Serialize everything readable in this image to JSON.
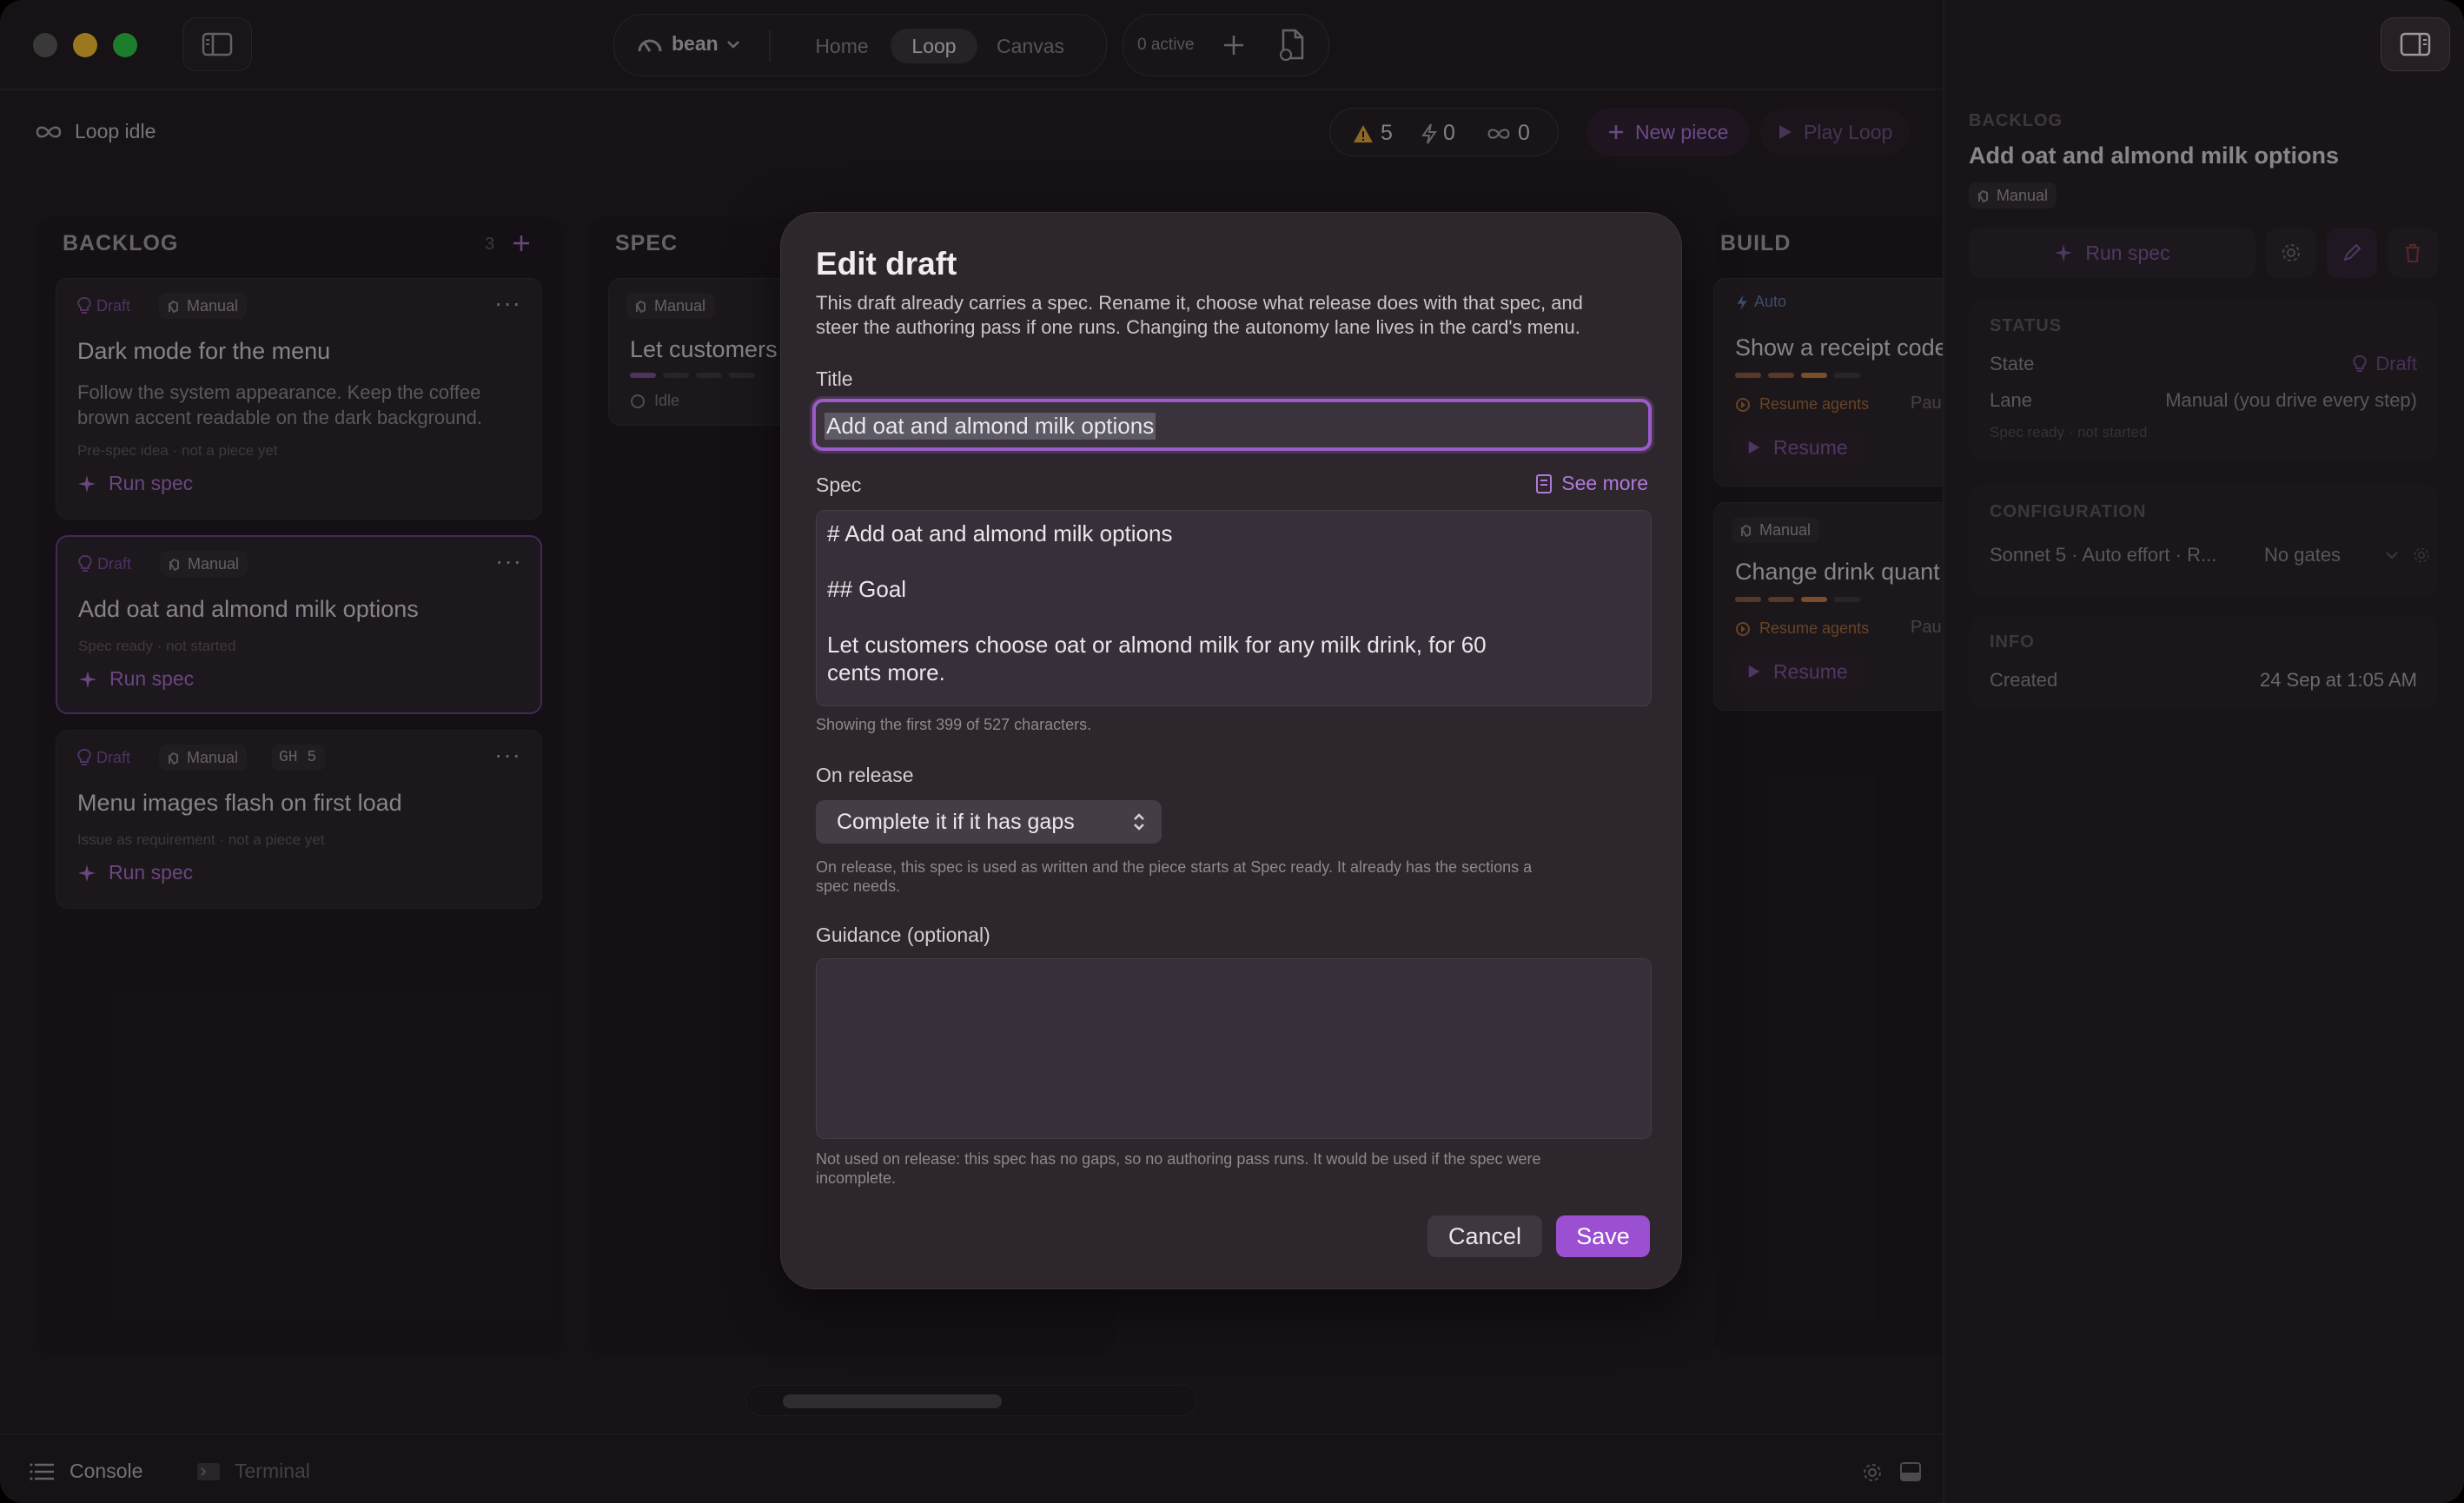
{
  "titlebar": {
    "project": "bean",
    "tabs": [
      "Home",
      "Loop",
      "Canvas"
    ],
    "active_tab": "Loop",
    "active_count": "0 active"
  },
  "toolbar": {
    "status": "Loop idle",
    "counts": {
      "warnings": "5",
      "running": "0",
      "loops": "0"
    },
    "new_piece": "New piece",
    "play_loop": "Play Loop"
  },
  "board": {
    "backlog": {
      "title": "BACKLOG",
      "count": "3",
      "cards": [
        {
          "status": "Draft",
          "lane": "Manual",
          "title": "Dark mode for the menu",
          "desc_line1": "Follow the system appearance. Keep the coffee",
          "desc_line2": "brown accent readable on the dark background.",
          "sub": "Pre-spec idea · not a piece yet",
          "action": "Run spec"
        },
        {
          "status": "Draft",
          "lane": "Manual",
          "title": "Add oat and almond milk options",
          "sub": "Spec ready · not started",
          "action": "Run spec"
        },
        {
          "status": "Draft",
          "lane": "Manual",
          "extra": "GH 5",
          "title": "Menu images flash on first load",
          "sub": "Issue as requirement · not a piece yet",
          "action": "Run spec"
        }
      ]
    },
    "spec": {
      "title": "SPEC",
      "cards": [
        {
          "lane": "Manual",
          "title": "Let customers",
          "state": "Idle"
        }
      ]
    },
    "build": {
      "title": "BUILD",
      "cards": [
        {
          "lane": "Auto",
          "title": "Show a receipt code",
          "agents": "Resume agents",
          "trail": "Pau",
          "action": "Resume"
        },
        {
          "lane": "Manual",
          "title": "Change drink quant",
          "agents": "Resume agents",
          "trail": "Pau",
          "action": "Resume"
        }
      ]
    }
  },
  "inspector": {
    "column": "BACKLOG",
    "title": "Add oat and almond milk options",
    "lane_badge": "Manual",
    "run_spec": "Run spec",
    "status": {
      "heading": "STATUS",
      "state_label": "State",
      "state_value": "Draft",
      "lane_label": "Lane",
      "lane_value": "Manual (you drive every step)",
      "note": "Spec ready · not started"
    },
    "configuration": {
      "heading": "CONFIGURATION",
      "summary": "Sonnet 5 · Auto effort · R...",
      "gates": "No gates"
    },
    "info": {
      "heading": "INFO",
      "created_label": "Created",
      "created_value": "24 Sep at 1:05 AM"
    }
  },
  "bottombar": {
    "console": "Console",
    "terminal": "Terminal"
  },
  "modal": {
    "title": "Edit draft",
    "intro_line1": "This draft already carries a spec. Rename it, choose what release does with that spec, and",
    "intro_line2": "steer the authoring pass if one runs. Changing the autonomy lane lives in the card's menu.",
    "title_label": "Title",
    "title_value": "Add oat and almond milk options",
    "spec_label": "Spec",
    "see_more": "See more",
    "spec_lines": [
      "# Add oat and almond milk options",
      "",
      "## Goal",
      "",
      "Let customers choose oat or almond milk for any milk drink, for 60",
      "cents more."
    ],
    "spec_hint": "Showing the first 399 of 527 characters.",
    "release_label": "On release",
    "release_value": "Complete it if it has gaps",
    "release_help_line1": "On release, this spec is used as written and the piece starts at Spec ready. It already has the sections a",
    "release_help_line2": "spec needs.",
    "guidance_label": "Guidance (optional)",
    "guidance_value": "",
    "guidance_help_line1": "Not used on release: this spec has no gaps, so no authoring pass runs. It would be used if the spec were",
    "guidance_help_line2": "incomplete.",
    "cancel": "Cancel",
    "save": "Save"
  },
  "colors": {
    "accent": "#9b4fd1",
    "accent_text": "#b580dc",
    "warning": "#e1a23c",
    "traffic_red": "#ee5f57",
    "traffic_yellow": "#f6be2f",
    "traffic_green": "#29c840"
  }
}
